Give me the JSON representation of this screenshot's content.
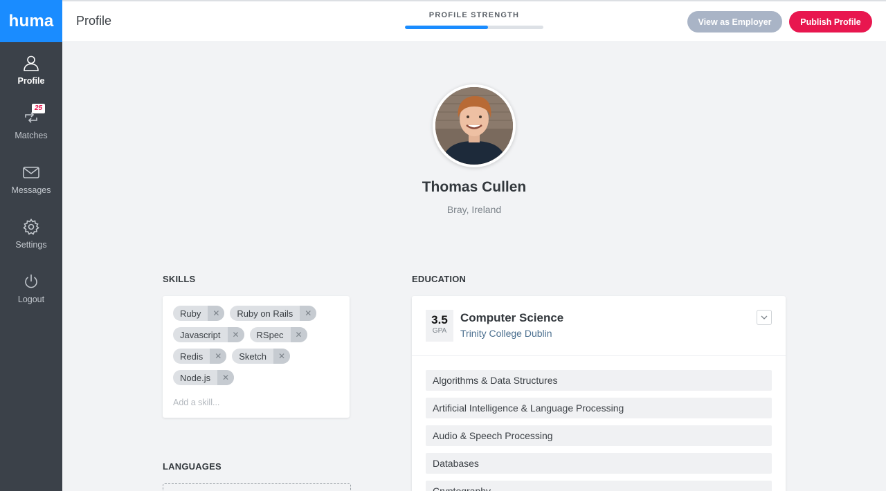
{
  "app": {
    "logo": "huma"
  },
  "sidebar": {
    "items": [
      {
        "label": "Profile",
        "icon": "user-icon",
        "active": true
      },
      {
        "label": "Matches",
        "icon": "matches-icon",
        "badge": "25"
      },
      {
        "label": "Messages",
        "icon": "envelope-icon"
      },
      {
        "label": "Settings",
        "icon": "gear-icon"
      },
      {
        "label": "Logout",
        "icon": "power-icon"
      }
    ]
  },
  "header": {
    "title": "Profile",
    "strength_label": "PROFILE STRENGTH",
    "strength_percent": 60,
    "view_as_employer": "View as Employer",
    "publish_profile": "Publish Profile"
  },
  "profile": {
    "name": "Thomas Cullen",
    "location": "Bray, Ireland"
  },
  "skills": {
    "title": "SKILLS",
    "items": [
      "Ruby",
      "Ruby on Rails",
      "Javascript",
      "RSpec",
      "Redis",
      "Sketch",
      "Node.js"
    ],
    "remove_glyph": "✕",
    "add_placeholder": "Add a skill..."
  },
  "languages": {
    "title": "LANGUAGES"
  },
  "education": {
    "title": "EDUCATION",
    "gpa": "3.5",
    "gpa_label": "GPA",
    "degree": "Computer Science",
    "school": "Trinity College Dublin",
    "modules": [
      "Algorithms & Data Structures",
      "Artificial Intelligence & Language Processing",
      "Audio & Speech Processing",
      "Databases",
      "Cryptography"
    ]
  },
  "colors": {
    "accent": "#1a8cff",
    "publish": "#e8174f",
    "employer_button": "#a9b4c6",
    "sidebar": "#3b4149"
  }
}
